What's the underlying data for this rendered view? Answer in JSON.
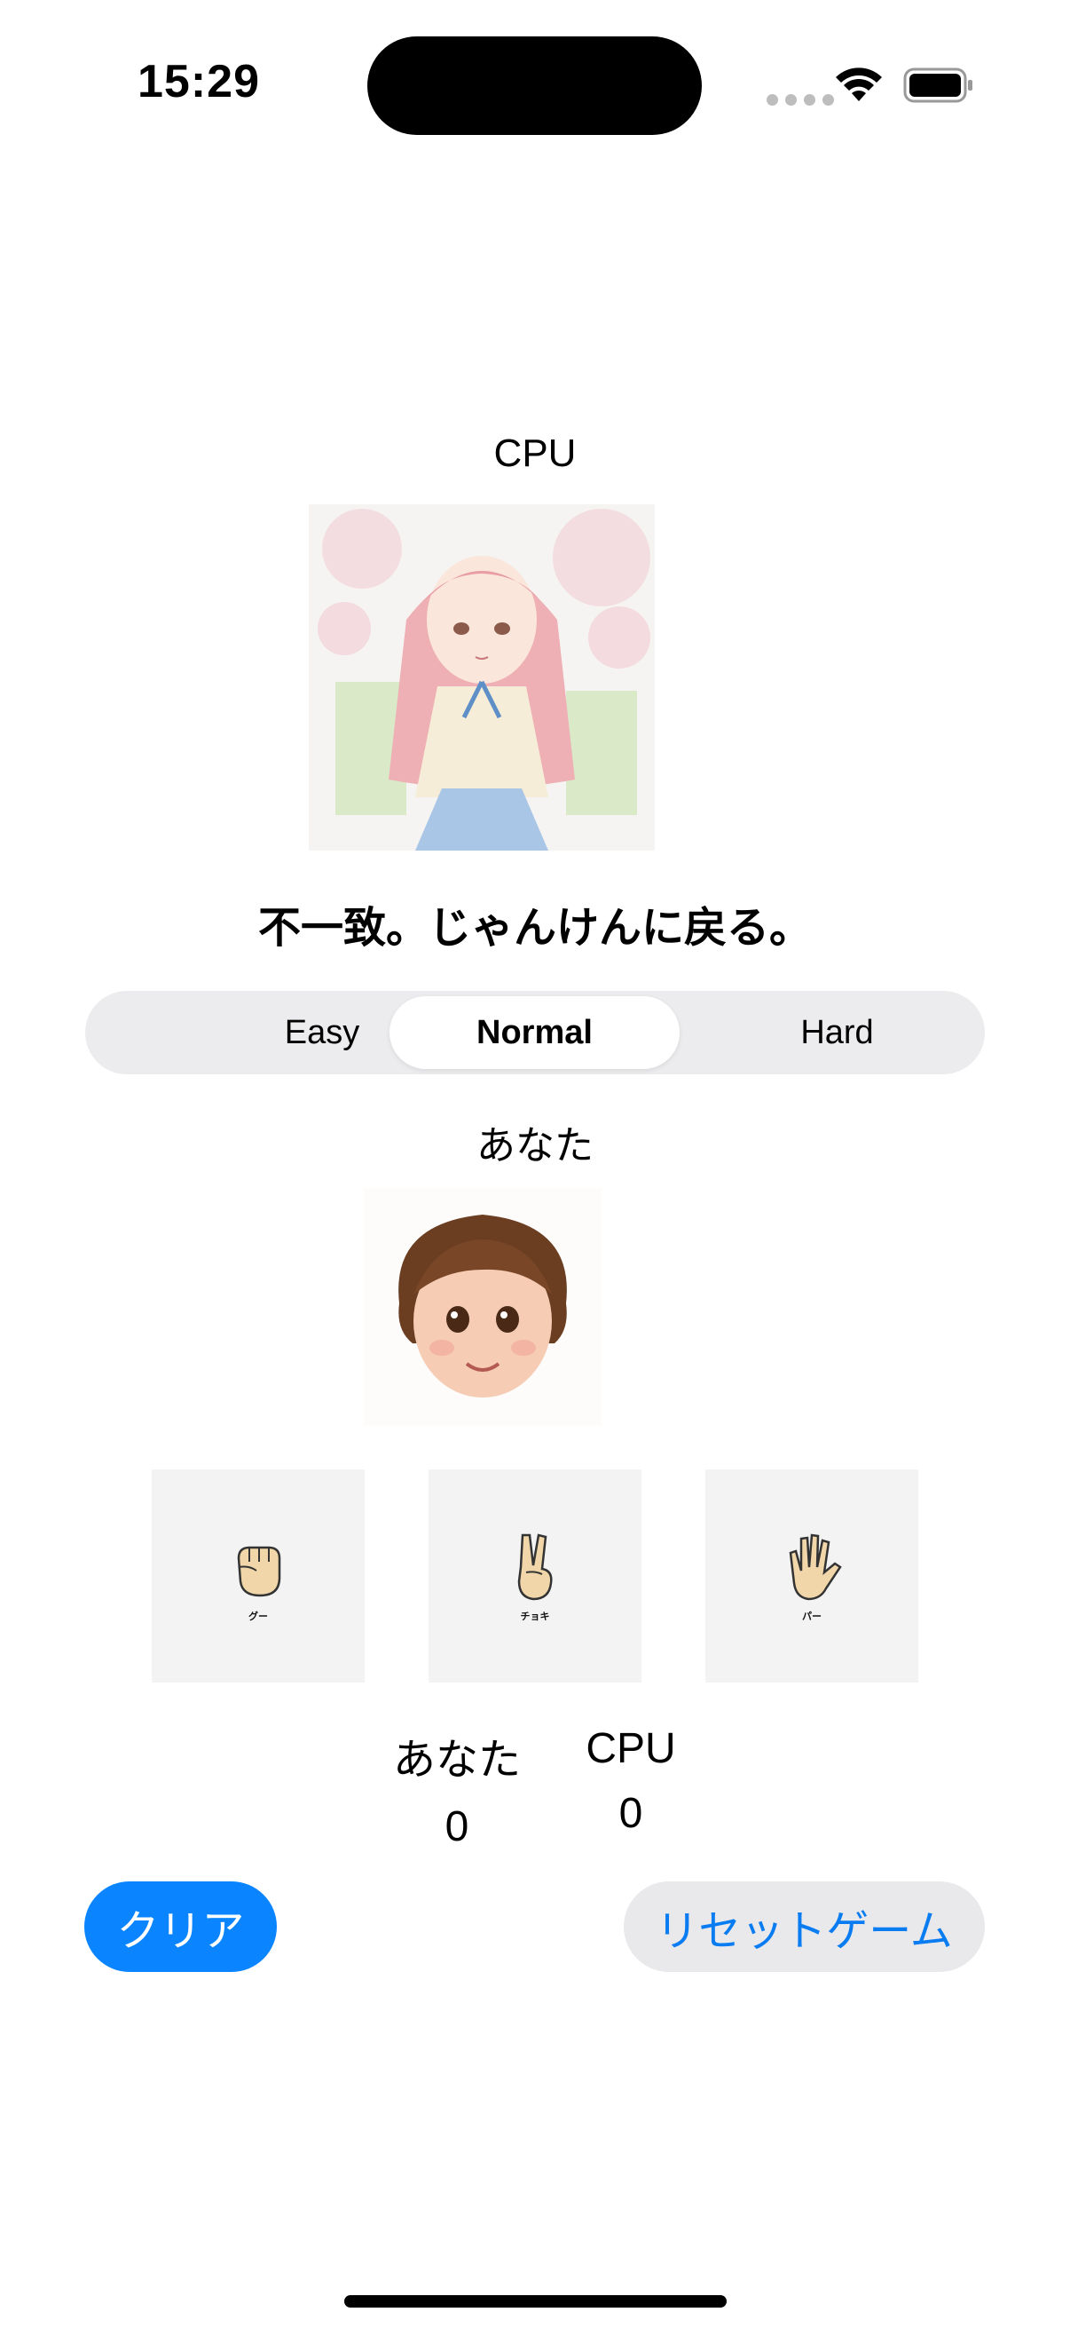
{
  "status_bar": {
    "time": "15:29"
  },
  "cpu": {
    "label": "CPU",
    "avatar": "cpu-girl-portrait"
  },
  "result": {
    "text": "不一致。じゃんけんに戻る。"
  },
  "difficulty": {
    "options": [
      "Easy",
      "Normal",
      "Hard"
    ],
    "selected": "Normal"
  },
  "player": {
    "label": "あなた",
    "avatar": "player-boy-portrait"
  },
  "hands": [
    {
      "caption": "グー",
      "icon": "rock-fist-icon"
    },
    {
      "caption": "チョキ",
      "icon": "scissors-hand-icon"
    },
    {
      "caption": "パー",
      "icon": "paper-hand-icon"
    }
  ],
  "score": {
    "you_label": "あなた",
    "you_value": "0",
    "cpu_label": "CPU",
    "cpu_value": "0"
  },
  "buttons": {
    "clear": "クリア",
    "reset": "リセットゲーム"
  },
  "colors": {
    "accent": "#0a84ff",
    "segment_bg": "#ececee",
    "tile_bg": "#f3f3f3"
  }
}
